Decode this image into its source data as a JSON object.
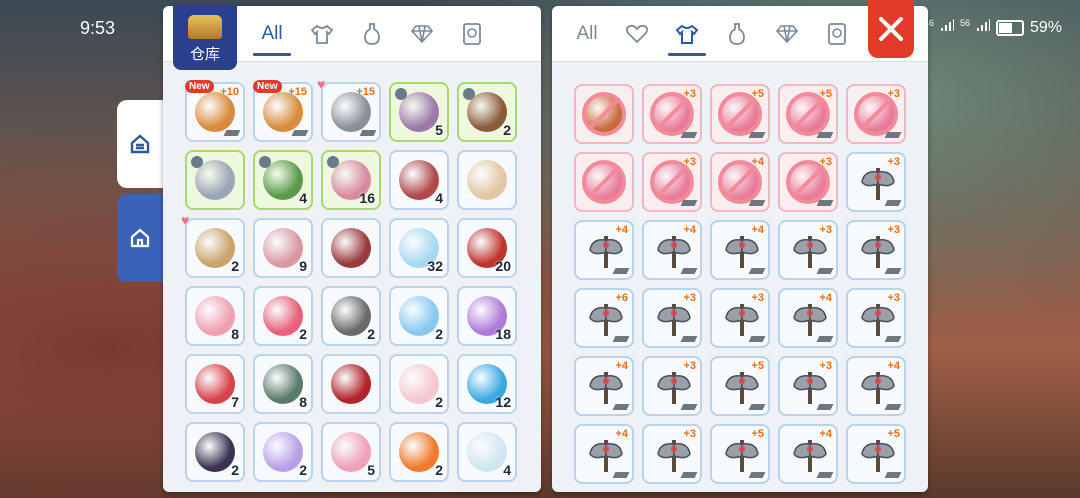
{
  "status": {
    "time": "9:53",
    "battery": "59%",
    "signal_a": "46",
    "signal_b": "56"
  },
  "storage": {
    "title": "仓库"
  },
  "left_tabs": [
    "All"
  ],
  "right_tabs": [
    "All"
  ],
  "left_items": [
    {
      "refine": "+10",
      "badge": "New",
      "art": "#d98a3a",
      "tone": "blue"
    },
    {
      "refine": "+15",
      "badge": "New",
      "art": "#d98a3a",
      "tone": "blue"
    },
    {
      "refine": "+15",
      "fav": true,
      "art": "#8a8f99",
      "tone": "blue"
    },
    {
      "count": "5",
      "art": "#9a7aa8",
      "tone": "green"
    },
    {
      "count": "2",
      "art": "#8a5a3a",
      "tone": "green"
    },
    {
      "art": "#9aa5b5",
      "tone": "green"
    },
    {
      "count": "4",
      "art": "#5a9a4a",
      "tone": "green"
    },
    {
      "count": "16",
      "art": "#d98aa0",
      "tone": "green"
    },
    {
      "count": "4",
      "art": "#b04a4a",
      "tone": "blue"
    },
    {
      "art": "#e2c7a3",
      "tone": "blue"
    },
    {
      "count": "2",
      "fav": true,
      "art": "#c9a36a",
      "tone": "blue"
    },
    {
      "count": "9",
      "art": "#d89aa0",
      "tone": "blue"
    },
    {
      "art": "#9a3a3a",
      "tone": "blue"
    },
    {
      "count": "32",
      "art": "#a8d8f0",
      "tone": "blue"
    },
    {
      "count": "20",
      "art": "#c0342e",
      "tone": "blue"
    },
    {
      "count": "8",
      "art": "#f0a0b0",
      "tone": "blue"
    },
    {
      "count": "2",
      "art": "#e8607a",
      "tone": "blue"
    },
    {
      "count": "2",
      "art": "#6a6a6a",
      "tone": "blue"
    },
    {
      "count": "2",
      "art": "#8ac8f0",
      "tone": "blue"
    },
    {
      "count": "18",
      "art": "#b07ad8",
      "tone": "blue"
    },
    {
      "count": "7",
      "art": "#d8424a",
      "tone": "blue"
    },
    {
      "count": "8",
      "art": "#5a7a6a",
      "tone": "blue"
    },
    {
      "art": "#b0242a",
      "tone": "blue"
    },
    {
      "count": "2",
      "art": "#f4c8d0",
      "tone": "blue"
    },
    {
      "count": "12",
      "art": "#3aa8e0",
      "tone": "blue"
    },
    {
      "count": "2",
      "art": "#3a3250",
      "tone": "blue"
    },
    {
      "count": "2",
      "art": "#b8a0e8",
      "tone": "blue"
    },
    {
      "count": "5",
      "art": "#f0a0b8",
      "tone": "blue"
    },
    {
      "count": "2",
      "art": "#f07a2a",
      "tone": "blue"
    },
    {
      "count": "4",
      "art": "#cfe6f2",
      "tone": "blue"
    }
  ],
  "right_items": [
    {
      "kind": "unusable",
      "art": "#c86a3a"
    },
    {
      "kind": "unusable",
      "refine": "+3",
      "art": "#e87a9a"
    },
    {
      "kind": "unusable",
      "refine": "+5",
      "art": "#e87a9a"
    },
    {
      "kind": "unusable",
      "refine": "+5",
      "art": "#e87a9a"
    },
    {
      "kind": "unusable",
      "refine": "+3",
      "art": "#e87a9a"
    },
    {
      "kind": "unusable",
      "art": "#e87a9a"
    },
    {
      "kind": "unusable",
      "refine": "+3",
      "art": "#e87a9a"
    },
    {
      "kind": "unusable",
      "refine": "+4",
      "art": "#e87a9a"
    },
    {
      "kind": "unusable",
      "refine": "+3",
      "art": "#e87a9a"
    },
    {
      "kind": "axe",
      "refine": "+3"
    },
    {
      "kind": "axe",
      "refine": "+4"
    },
    {
      "kind": "axe",
      "refine": "+4"
    },
    {
      "kind": "axe",
      "refine": "+4"
    },
    {
      "kind": "axe",
      "refine": "+3"
    },
    {
      "kind": "axe",
      "refine": "+3"
    },
    {
      "kind": "axe",
      "refine": "+6"
    },
    {
      "kind": "axe",
      "refine": "+3"
    },
    {
      "kind": "axe",
      "refine": "+3"
    },
    {
      "kind": "axe",
      "refine": "+4"
    },
    {
      "kind": "axe",
      "refine": "+3"
    },
    {
      "kind": "axe",
      "refine": "+4"
    },
    {
      "kind": "axe",
      "refine": "+3"
    },
    {
      "kind": "axe",
      "refine": "+5"
    },
    {
      "kind": "axe",
      "refine": "+3"
    },
    {
      "kind": "axe",
      "refine": "+4"
    },
    {
      "kind": "axe",
      "refine": "+4"
    },
    {
      "kind": "axe",
      "refine": "+3"
    },
    {
      "kind": "axe",
      "refine": "+5"
    },
    {
      "kind": "axe",
      "refine": "+4"
    },
    {
      "kind": "axe",
      "refine": "+5"
    }
  ]
}
